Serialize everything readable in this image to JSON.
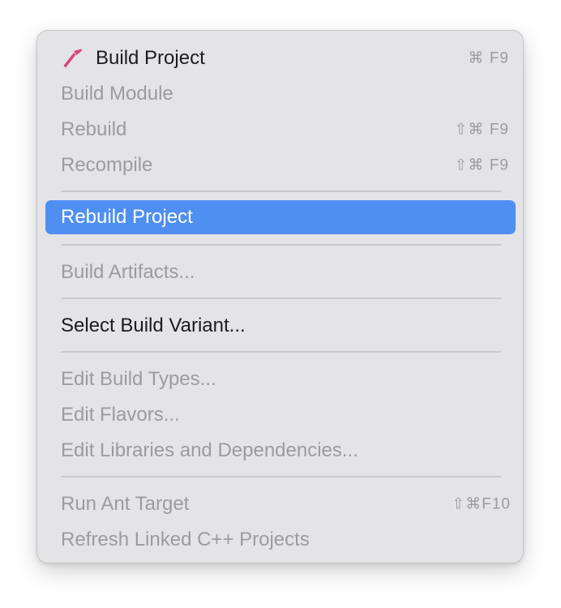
{
  "menu": {
    "items": [
      {
        "label": "Build Project",
        "shortcut": "⌘ F9",
        "icon": "hammer-icon",
        "state": "enabled"
      },
      {
        "label": "Build Module",
        "shortcut": "",
        "state": "disabled"
      },
      {
        "label": "Rebuild",
        "shortcut": "⇧⌘ F9",
        "state": "disabled"
      },
      {
        "label": "Recompile",
        "shortcut": "⇧⌘ F9",
        "state": "disabled"
      },
      {
        "label": "Rebuild Project",
        "shortcut": "",
        "state": "highlighted"
      },
      {
        "label": "Build Artifacts...",
        "shortcut": "",
        "state": "disabled"
      },
      {
        "label": "Select Build Variant...",
        "shortcut": "",
        "state": "enabled"
      },
      {
        "label": "Edit Build Types...",
        "shortcut": "",
        "state": "disabled"
      },
      {
        "label": "Edit Flavors...",
        "shortcut": "",
        "state": "disabled"
      },
      {
        "label": "Edit Libraries and Dependencies...",
        "shortcut": "",
        "state": "disabled"
      },
      {
        "label": "Run Ant Target",
        "shortcut": "⇧⌘F10",
        "state": "disabled"
      },
      {
        "label": "Refresh Linked C++ Projects",
        "shortcut": "",
        "state": "disabled"
      }
    ]
  },
  "colors": {
    "menu_background": "#e4e3e6",
    "highlight": "#4f8ff2",
    "enabled_text": "#1c1c1e",
    "disabled_text": "#9c9ba0",
    "hammer_icon": "#d6457a"
  }
}
